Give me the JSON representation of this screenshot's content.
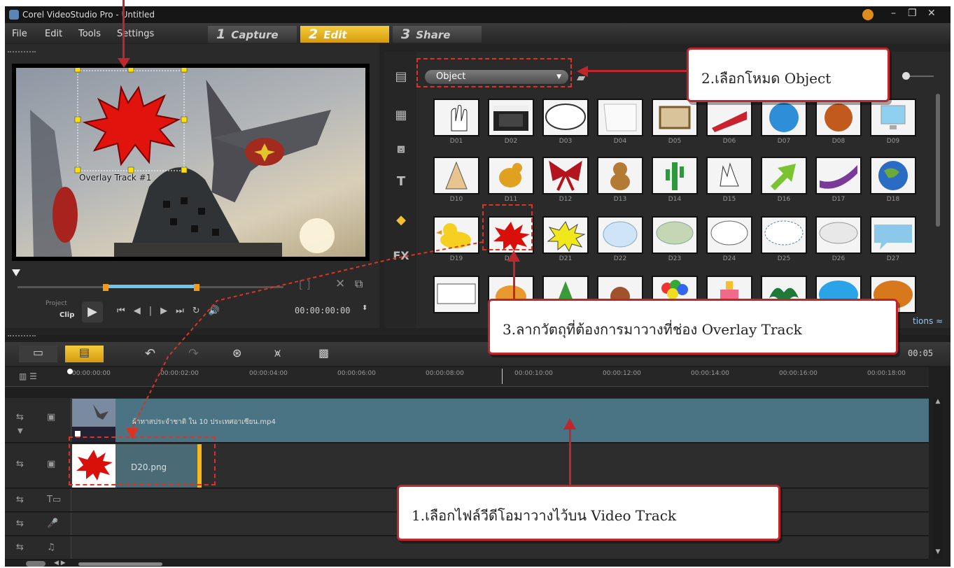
{
  "app": {
    "title": "Corel VideoStudio Pro - Untitled"
  },
  "menu": [
    "File",
    "Edit",
    "Tools",
    "Settings"
  ],
  "steps": [
    {
      "num": "1",
      "label": "Capture"
    },
    {
      "num": "2",
      "label": "Edit"
    },
    {
      "num": "3",
      "label": "Share"
    }
  ],
  "player": {
    "overlay_label": "Overlay Track #1",
    "mode_project": "Project",
    "mode_clip": "Clip",
    "timecode": "00:00:00:00"
  },
  "library": {
    "category": "Object",
    "items": [
      "D01",
      "D02",
      "D03",
      "D04",
      "D05",
      "D06",
      "D07",
      "D08",
      "D09",
      "D10",
      "D11",
      "D12",
      "D13",
      "D14",
      "D15",
      "D16",
      "D17",
      "D18",
      "D19",
      "D20",
      "D21",
      "D22",
      "D23",
      "D24",
      "D25",
      "D26",
      "D27"
    ],
    "options_label": "tions"
  },
  "timeline": {
    "duration": "00:05",
    "ruler": [
      "00:00:00:00",
      "00:00:02:00",
      "00:00:04:00",
      "00:00:06:00",
      "00:00:08:00",
      "00:00:10:00",
      "00:00:12:00",
      "00:00:14:00",
      "00:00:16:00",
      "00:00:18:00"
    ],
    "video_clip": "ผ้าทาสประจำชาติ ใน 10 ประเทศอาเซียน.mp4",
    "overlay_clip": "D20.png"
  },
  "callouts": {
    "c1": "1.เลือกไฟล์วีดีโอมาวางไว้บน  Video Track",
    "c2": "2.เลือกโหมด Object",
    "c3": "3.ลากวัตถุที่ต้องการมาวางที่ช่อง  Overlay Track"
  },
  "colors": {
    "accent": "#f5b91c",
    "callout_border": "#c0272d",
    "video_track": "#4a7483"
  }
}
